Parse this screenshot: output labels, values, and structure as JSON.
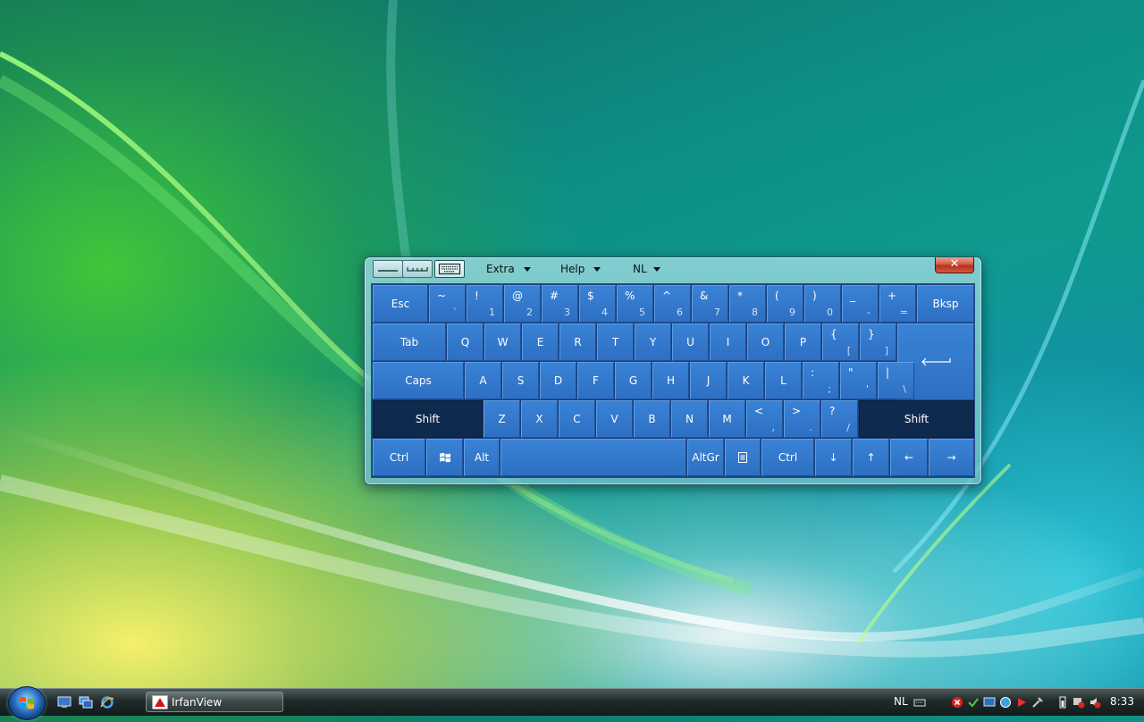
{
  "taskbar": {
    "app_label": "IrfanView",
    "language": "NL",
    "clock": "8:33"
  },
  "osk": {
    "menus": {
      "extra": "Extra",
      "help": "Help",
      "lang": "NL"
    },
    "close_glyph": "✕",
    "keys": {
      "esc": "Esc",
      "bksp": "Bksp",
      "tab": "Tab",
      "caps": "Caps",
      "shift_left": "Shift",
      "shift_right": "Shift",
      "ctrl_left": "Ctrl",
      "alt": "Alt",
      "altgr": "AltGr",
      "ctrl_right": "Ctrl",
      "arrow_down": "↓",
      "arrow_up": "↑",
      "arrow_left": "←",
      "arrow_right": "→",
      "enter": "⟵"
    },
    "number_row": [
      {
        "up": "~",
        "lo": "`"
      },
      {
        "up": "!",
        "lo": "1"
      },
      {
        "up": "@",
        "lo": "2"
      },
      {
        "up": "#",
        "lo": "3"
      },
      {
        "up": "$",
        "lo": "4"
      },
      {
        "up": "%",
        "lo": "5"
      },
      {
        "up": "^",
        "lo": "6"
      },
      {
        "up": "&",
        "lo": "7"
      },
      {
        "up": "*",
        "lo": "8"
      },
      {
        "up": "(",
        "lo": "9"
      },
      {
        "up": ")",
        "lo": "0"
      },
      {
        "up": "_",
        "lo": "-"
      },
      {
        "up": "+",
        "lo": "="
      }
    ],
    "row_q": [
      "Q",
      "W",
      "E",
      "R",
      "T",
      "Y",
      "U",
      "I",
      "O",
      "P"
    ],
    "row_q_sym": [
      {
        "up": "{",
        "lo": "["
      },
      {
        "up": "}",
        "lo": "]"
      }
    ],
    "row_a": [
      "A",
      "S",
      "D",
      "F",
      "G",
      "H",
      "J",
      "K",
      "L"
    ],
    "row_a_sym": [
      {
        "up": ":",
        "lo": ";"
      },
      {
        "up": "\"",
        "lo": "'"
      },
      {
        "up": "|",
        "lo": "\\"
      }
    ],
    "row_z": [
      "Z",
      "X",
      "C",
      "V",
      "B",
      "N",
      "M"
    ],
    "row_z_sym": [
      {
        "up": "<",
        "lo": ","
      },
      {
        "up": ">",
        "lo": "."
      },
      {
        "up": "?",
        "lo": "/"
      }
    ]
  }
}
